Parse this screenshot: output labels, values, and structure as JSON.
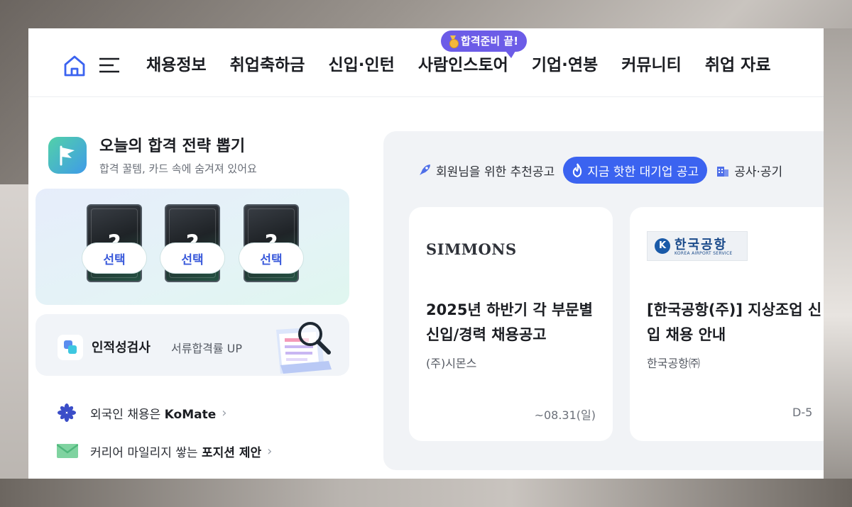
{
  "nav": {
    "items": [
      "채용정보",
      "취업축하금",
      "신입·인턴",
      "사람인스토어",
      "기업·연봉",
      "커뮤니티",
      "취업 자료"
    ],
    "promo_badge": "합격준비 끝!"
  },
  "strategy": {
    "title": "오늘의 합격 전략 뽑기",
    "subtitle": "합격 꿀템, 카드 속에 숨겨져 있어요",
    "cards": [
      {
        "face": "?",
        "button": "선택"
      },
      {
        "face": "?",
        "button": "선택"
      },
      {
        "face": "?",
        "button": "선택"
      }
    ]
  },
  "aptitude": {
    "title": "인적성검사",
    "subtitle": "서류합격률 UP"
  },
  "links": [
    {
      "prefix": "외국인 채용은 ",
      "bold": "KoMate"
    },
    {
      "prefix": "커리어 마일리지 쌓는 ",
      "bold": "포지션 제안"
    }
  ],
  "filters": {
    "recommended": "회원님을 위한 추천공고",
    "hot": "지금 핫한 대기업 공고",
    "public": "공사·공기"
  },
  "jobs": [
    {
      "logo_text": "SIMMONS",
      "title": "2025년 하반기 각 부문별 신입/경력 채용공고",
      "company": "(주)시몬스",
      "deadline": "~08.31(일)"
    },
    {
      "logo_text": "한국공항",
      "logo_sub": "KOREA AIRPORT SERVICE",
      "title": "[한국공항(주)] 지상조업 신입 채용 안내",
      "company": "한국공항㈜",
      "deadline": "D-5"
    }
  ],
  "colors": {
    "accent": "#3b63f0",
    "promo": "#6c5ce7",
    "brand_select": "#3b5bdb"
  }
}
